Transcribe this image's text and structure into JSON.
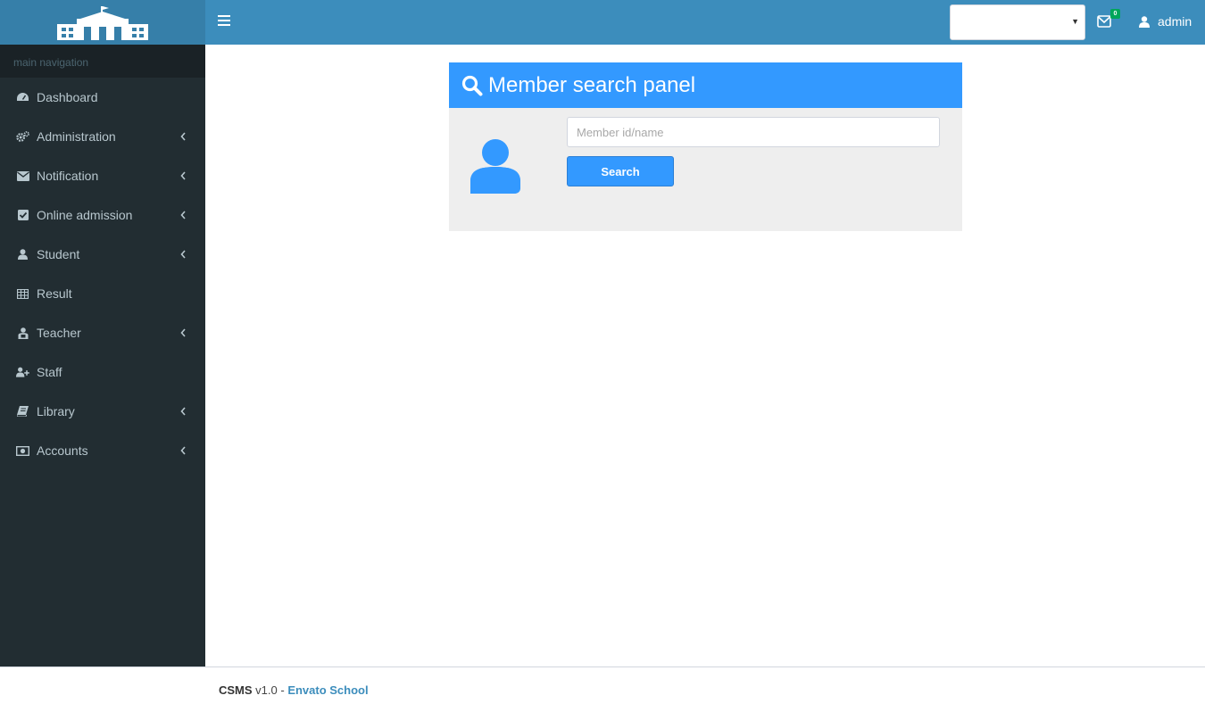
{
  "header": {
    "logo_icon": "school-building-icon",
    "toggle_icon": "hamburger-icon",
    "session_select_value": "",
    "mail_icon": "envelope-icon",
    "mail_badge": "0",
    "user_icon": "user-icon",
    "user_name": "admin"
  },
  "sidebar": {
    "header": "main navigation",
    "items": [
      {
        "label": "Dashboard",
        "icon": "dashboard-icon",
        "has_submenu": false
      },
      {
        "label": "Administration",
        "icon": "gears-icon",
        "has_submenu": true
      },
      {
        "label": "Notification",
        "icon": "envelope-icon",
        "has_submenu": true
      },
      {
        "label": "Online admission",
        "icon": "check-square-icon",
        "has_submenu": true
      },
      {
        "label": "Student",
        "icon": "user-icon",
        "has_submenu": true
      },
      {
        "label": "Result",
        "icon": "table-icon",
        "has_submenu": false
      },
      {
        "label": "Teacher",
        "icon": "teacher-icon",
        "has_submenu": true
      },
      {
        "label": "Staff",
        "icon": "user-plus-icon",
        "has_submenu": false
      },
      {
        "label": "Library",
        "icon": "book-icon",
        "has_submenu": true
      },
      {
        "label": "Accounts",
        "icon": "money-icon",
        "has_submenu": true
      }
    ]
  },
  "panel": {
    "title": "Member search panel",
    "title_icon": "search-icon",
    "avatar_icon": "user-icon",
    "input_placeholder": "Member id/name",
    "input_value": "",
    "button_label": "Search"
  },
  "footer": {
    "brand": "CSMS",
    "version": " v1.0 - ",
    "link": "Envato School"
  },
  "colors": {
    "header_bg": "#3c8dbc",
    "logo_bg": "#367fa9",
    "sidebar_bg": "#222d32",
    "panel_accent": "#3399ff",
    "panel_body": "#eeeeee"
  }
}
